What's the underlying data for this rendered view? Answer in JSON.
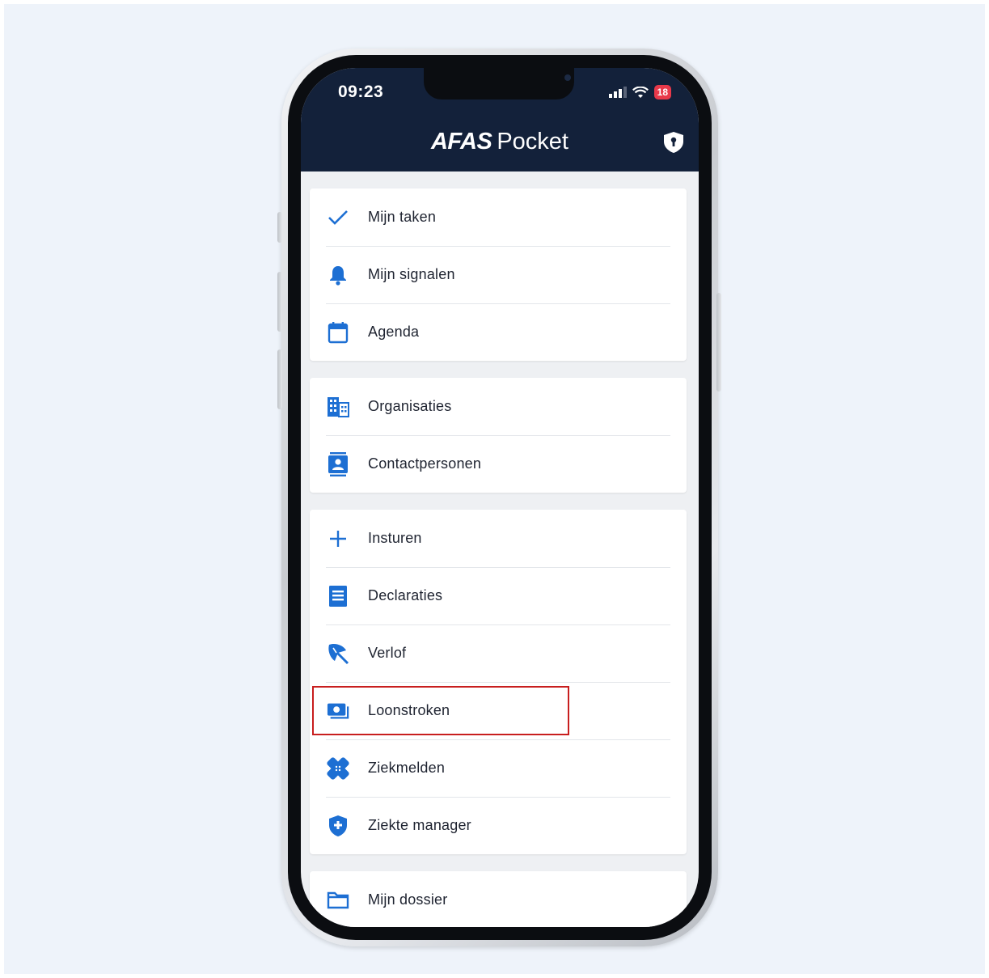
{
  "status_bar": {
    "time": "09:23",
    "battery": "18"
  },
  "header": {
    "brand_bold": "AFAS",
    "brand_light": "Pocket"
  },
  "colors": {
    "header_bg": "#13213a",
    "accent": "#1d6fd3",
    "highlight": "#c81e1e"
  },
  "menu": {
    "group1": [
      {
        "label": "Mijn taken",
        "icon": "checkmark-icon"
      },
      {
        "label": "Mijn signalen",
        "icon": "bell-icon"
      },
      {
        "label": "Agenda",
        "icon": "calendar-icon"
      }
    ],
    "group2": [
      {
        "label": "Organisaties",
        "icon": "building-icon"
      },
      {
        "label": "Contactpersonen",
        "icon": "contact-card-icon"
      }
    ],
    "group3": [
      {
        "label": "Insturen",
        "icon": "plus-icon"
      },
      {
        "label": "Declaraties",
        "icon": "receipt-icon"
      },
      {
        "label": "Verlof",
        "icon": "beach-umbrella-icon"
      },
      {
        "label": "Loonstroken",
        "icon": "money-icon"
      },
      {
        "label": "Ziekmelden",
        "icon": "bandage-icon"
      },
      {
        "label": "Ziekte manager",
        "icon": "shield-plus-icon"
      }
    ],
    "group4": [
      {
        "label": "Mijn dossier",
        "icon": "folder-icon"
      }
    ]
  }
}
